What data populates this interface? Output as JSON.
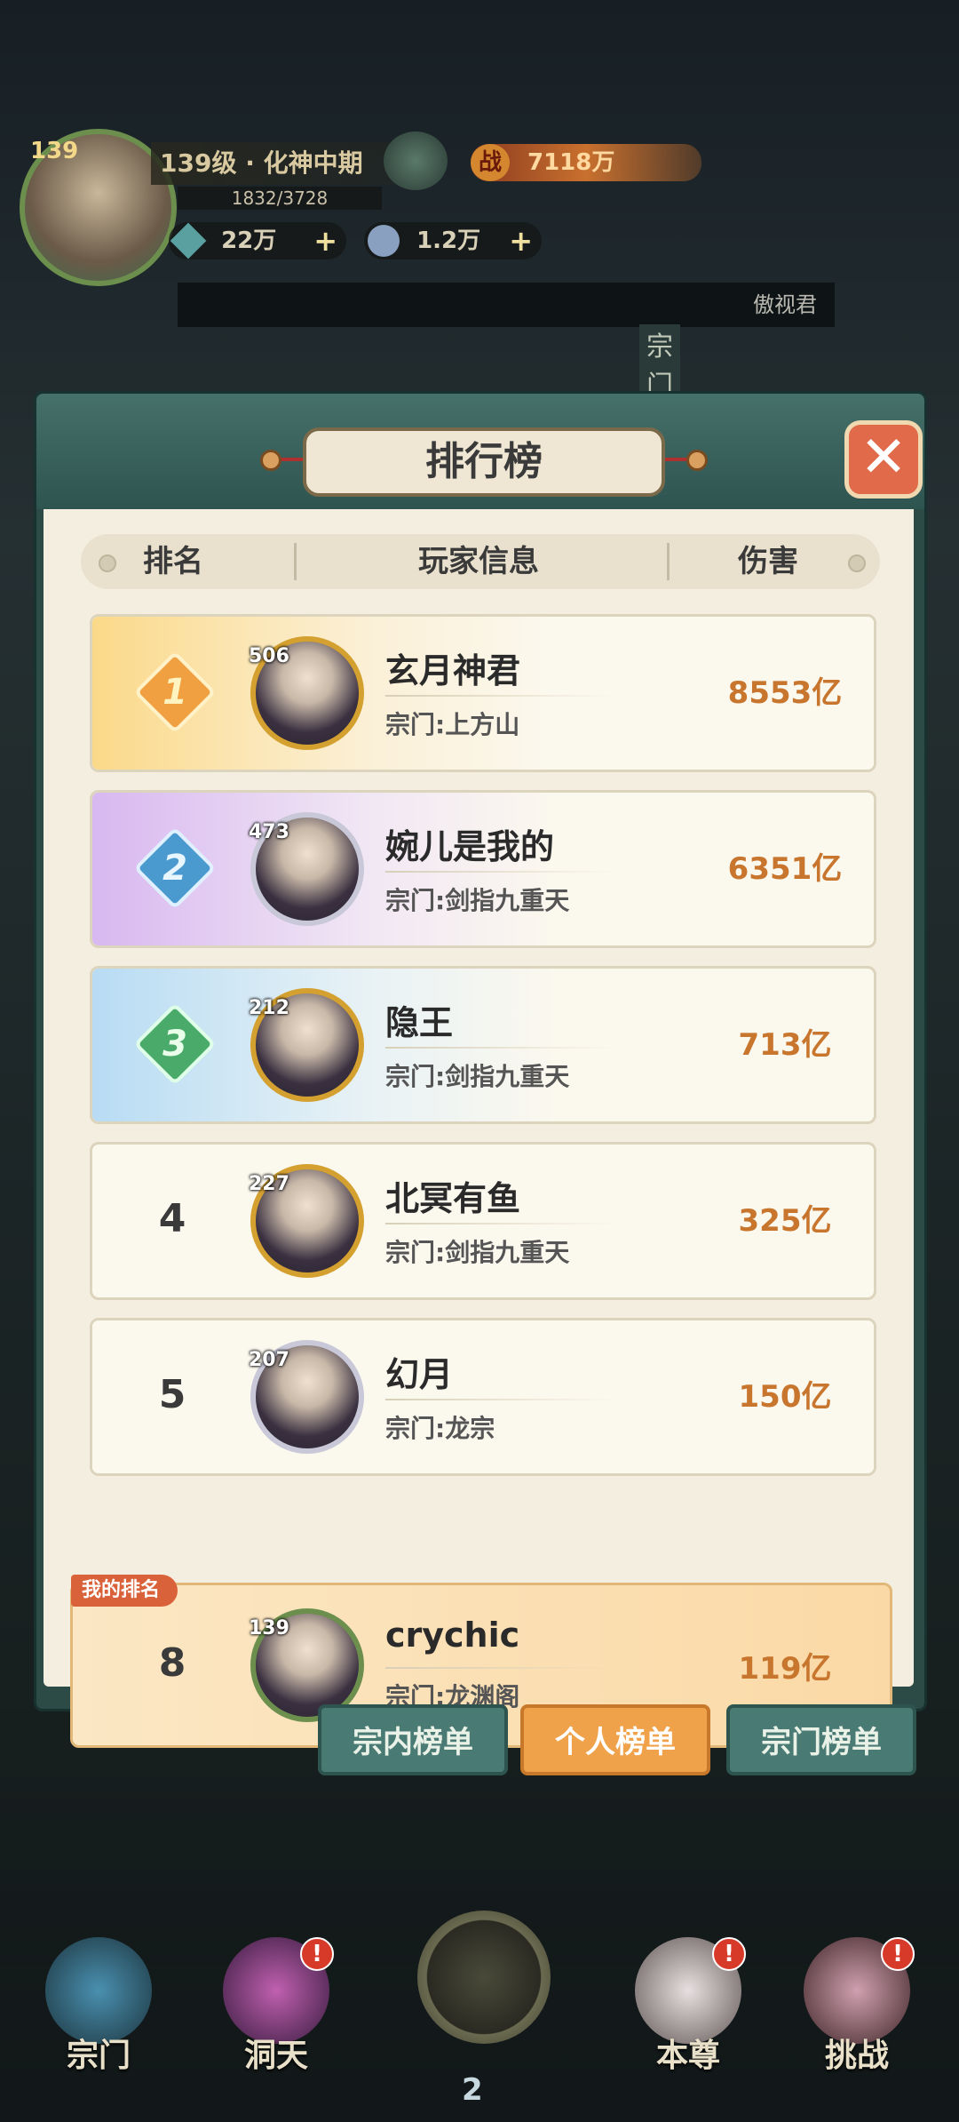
{
  "hud": {
    "avatar_level": "139",
    "level_text": "139级 · 化神中期",
    "exp": "1832/3728",
    "power": "7118万",
    "power_badge": "战",
    "res1": "22万",
    "res2": "1.2万",
    "banner_text": "傲视君",
    "side_tab": "宗门"
  },
  "panel": {
    "title": "排行榜",
    "close_label": "✕",
    "columns": [
      "排名",
      "玩家信息",
      "伤害"
    ],
    "rows": [
      {
        "rank": "1",
        "level": "506",
        "name": "玄月神君",
        "sect": "宗门:上方山",
        "damage": "8553亿"
      },
      {
        "rank": "2",
        "level": "473",
        "name": "婉儿是我的",
        "sect": "宗门:剑指九重天",
        "damage": "6351亿"
      },
      {
        "rank": "3",
        "level": "212",
        "name": "隐王",
        "sect": "宗门:剑指九重天",
        "damage": "713亿"
      },
      {
        "rank": "4",
        "level": "227",
        "name": "北冥有鱼",
        "sect": "宗门:剑指九重天",
        "damage": "325亿"
      },
      {
        "rank": "5",
        "level": "207",
        "name": "幻月",
        "sect": "宗门:龙宗",
        "damage": "150亿"
      }
    ],
    "mine": {
      "tag": "我的排名",
      "rank": "8",
      "level": "139",
      "name": "crychic",
      "sect": "宗门:龙渊阁",
      "damage": "119亿"
    }
  },
  "tabs": {
    "tab1": "宗内榜单",
    "tab2": "个人榜单",
    "tab3": "宗门榜单"
  },
  "nav": {
    "item1": "宗门",
    "item2": "洞天",
    "item3": "本尊",
    "item4": "挑战",
    "badge": "!",
    "center_count": "2"
  },
  "colors": {
    "accent": "#c8752e",
    "frame": "#2c4a46",
    "active_tab": "#f0a24a"
  }
}
